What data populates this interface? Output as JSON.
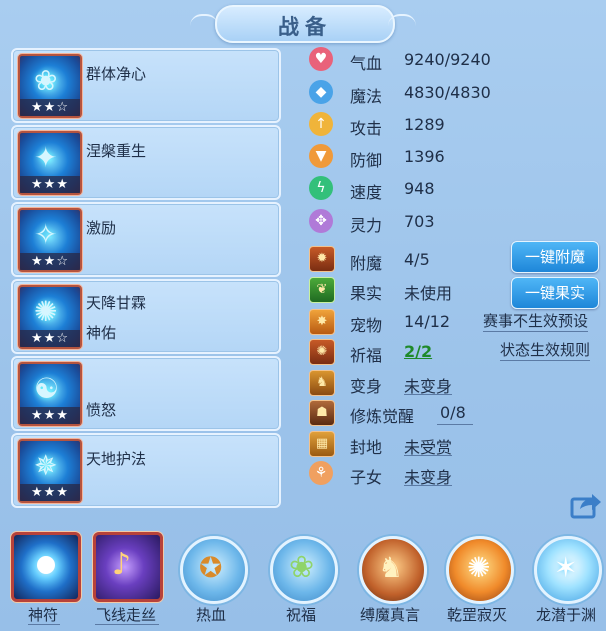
{
  "title": "战备",
  "skills": [
    {
      "name": "群体净心",
      "stars": "★★☆",
      "icon": "purify-skill-icon"
    },
    {
      "name": "涅槃重生",
      "stars": "★★★",
      "icon": "rebirth-skill-icon"
    },
    {
      "name": "激励",
      "stars": "★★☆",
      "icon": "inspire-skill-icon"
    },
    {
      "name": "天降甘霖",
      "name2": "神佑",
      "stars": "★★☆",
      "icon": "rain-skill-icon"
    },
    {
      "name": "愤怒",
      "stars": "★★★",
      "icon": "rage-skill-icon"
    },
    {
      "name": "天地护法",
      "stars": "★★★",
      "icon": "guardian-skill-icon"
    }
  ],
  "stats": [
    {
      "label": "气血",
      "value": "9240/9240",
      "icon": "heart-icon",
      "color": "#e9627a"
    },
    {
      "label": "魔法",
      "value": "4830/4830",
      "icon": "mana-icon",
      "color": "#4aa3e8"
    },
    {
      "label": "攻击",
      "value": "1289",
      "icon": "sword-icon",
      "color": "#f0b43a"
    },
    {
      "label": "防御",
      "value": "1396",
      "icon": "shield-icon",
      "color": "#f09a3a"
    },
    {
      "label": "速度",
      "value": "948",
      "icon": "speed-icon",
      "color": "#33c07a"
    },
    {
      "label": "灵力",
      "value": "703",
      "icon": "spirit-icon",
      "color": "#b07ad8"
    }
  ],
  "extras": {
    "enchant": {
      "label": "附魔",
      "value": "4/5"
    },
    "fruit": {
      "label": "果实",
      "value": "未使用"
    },
    "pet": {
      "label": "宠物",
      "value": "14/12"
    },
    "bless": {
      "label": "祈福",
      "value": "2/2"
    },
    "transform": {
      "label": "变身",
      "value": "未变身"
    },
    "cultivate": {
      "label": "修炼觉醒",
      "value": "0/8"
    },
    "fief": {
      "label": "封地",
      "value": "未受赏"
    },
    "children": {
      "label": "子女",
      "value": "未变身"
    }
  },
  "buttons": {
    "enchant_all": "一键附魔",
    "fruit_all": "一键果实"
  },
  "links": {
    "event_preset": "赛事不生效预设",
    "status_rule": "状态生效规则"
  },
  "bottom": [
    {
      "label": "神符",
      "icon": "talisman-icon"
    },
    {
      "label": "飞线走丝",
      "icon": "thread-icon"
    },
    {
      "label": "热血",
      "icon": "hot-blood-icon"
    },
    {
      "label": "祝福",
      "icon": "blessing-icon"
    },
    {
      "label": "缚魔真言",
      "icon": "bind-demon-icon"
    },
    {
      "label": "乾罡寂灭",
      "icon": "annihilate-icon"
    },
    {
      "label": "龙潜于渊",
      "icon": "dragon-icon"
    }
  ],
  "colors": {
    "accent_green": "#1f8a2a",
    "button_blue": "#1e86d9"
  }
}
